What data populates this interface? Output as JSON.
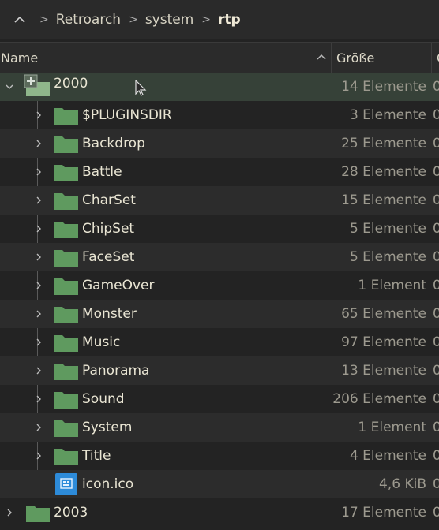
{
  "breadcrumb": {
    "items": [
      "Retroarch",
      "system",
      "rtp"
    ]
  },
  "header": {
    "name": "Name",
    "size": "Größe",
    "more": "G"
  },
  "rows": [
    {
      "label": "2000",
      "size": "14 Elemente",
      "clip": "0"
    },
    {
      "label": "$PLUGINSDIR",
      "size": "3 Elemente",
      "clip": "0"
    },
    {
      "label": "Backdrop",
      "size": "25 Elemente",
      "clip": "0"
    },
    {
      "label": "Battle",
      "size": "28 Elemente",
      "clip": "0"
    },
    {
      "label": "CharSet",
      "size": "15 Elemente",
      "clip": "0"
    },
    {
      "label": "ChipSet",
      "size": "5 Elemente",
      "clip": "0"
    },
    {
      "label": "FaceSet",
      "size": "5 Elemente",
      "clip": "0"
    },
    {
      "label": "GameOver",
      "size": "1 Element",
      "clip": "0"
    },
    {
      "label": "Monster",
      "size": "65 Elemente",
      "clip": "0"
    },
    {
      "label": "Music",
      "size": "97 Elemente",
      "clip": "0"
    },
    {
      "label": "Panorama",
      "size": "13 Elemente",
      "clip": "0"
    },
    {
      "label": "Sound",
      "size": "206 Elemente",
      "clip": "0"
    },
    {
      "label": "System",
      "size": "1 Element",
      "clip": "0"
    },
    {
      "label": "Title",
      "size": "4 Elemente",
      "clip": "0"
    },
    {
      "label": "icon.ico",
      "size": "4,6 KiB",
      "clip": "0"
    },
    {
      "label": "2003",
      "size": "17 Elemente",
      "clip": "0"
    }
  ],
  "icons": {
    "folder": "folder-icon",
    "file": "ico-file-icon"
  },
  "colors": {
    "background": "#232323",
    "alt_row": "#2c2c2c",
    "hover_row": "#364138",
    "folder": "#5f9a5f",
    "file_icon": "#2d8bd9"
  }
}
